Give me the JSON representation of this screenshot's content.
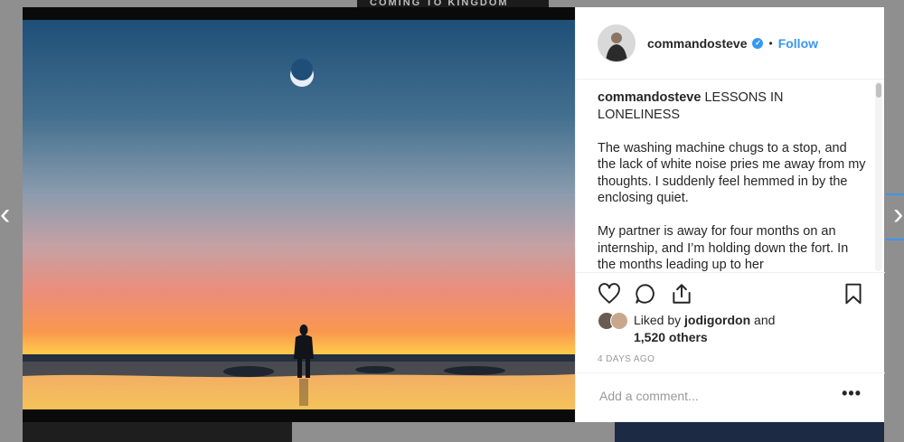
{
  "background": {
    "top_strip_text": "COMING TO KINGDOM"
  },
  "post": {
    "username": "commandosteve",
    "separator": "•",
    "follow_label": "Follow",
    "caption": {
      "username": "commandosteve",
      "title": "LESSONS IN LONELINESS",
      "paragraphs": [
        "The washing machine chugs to a stop, and the lack of white noise pries me away from my thoughts. I suddenly feel hemmed in by the enclosing quiet.",
        "My partner is away for four months on an internship, and I’m holding down the fort. In the months leading up to her"
      ]
    },
    "likes": {
      "prefix": "Liked by",
      "liker": "jodigordon",
      "conjunction": "and",
      "others": "1,520 others"
    },
    "timestamp": "4 DAYS AGO",
    "comment_placeholder": "Add a comment...",
    "more_label": "•••"
  },
  "nav": {
    "prev": "‹",
    "next": "›"
  },
  "icons": [
    "heart-icon",
    "comment-icon",
    "share-icon",
    "bookmark-icon",
    "verified-icon"
  ],
  "colors": {
    "accent": "#3897f0",
    "text": "#262626",
    "muted": "#999999"
  }
}
